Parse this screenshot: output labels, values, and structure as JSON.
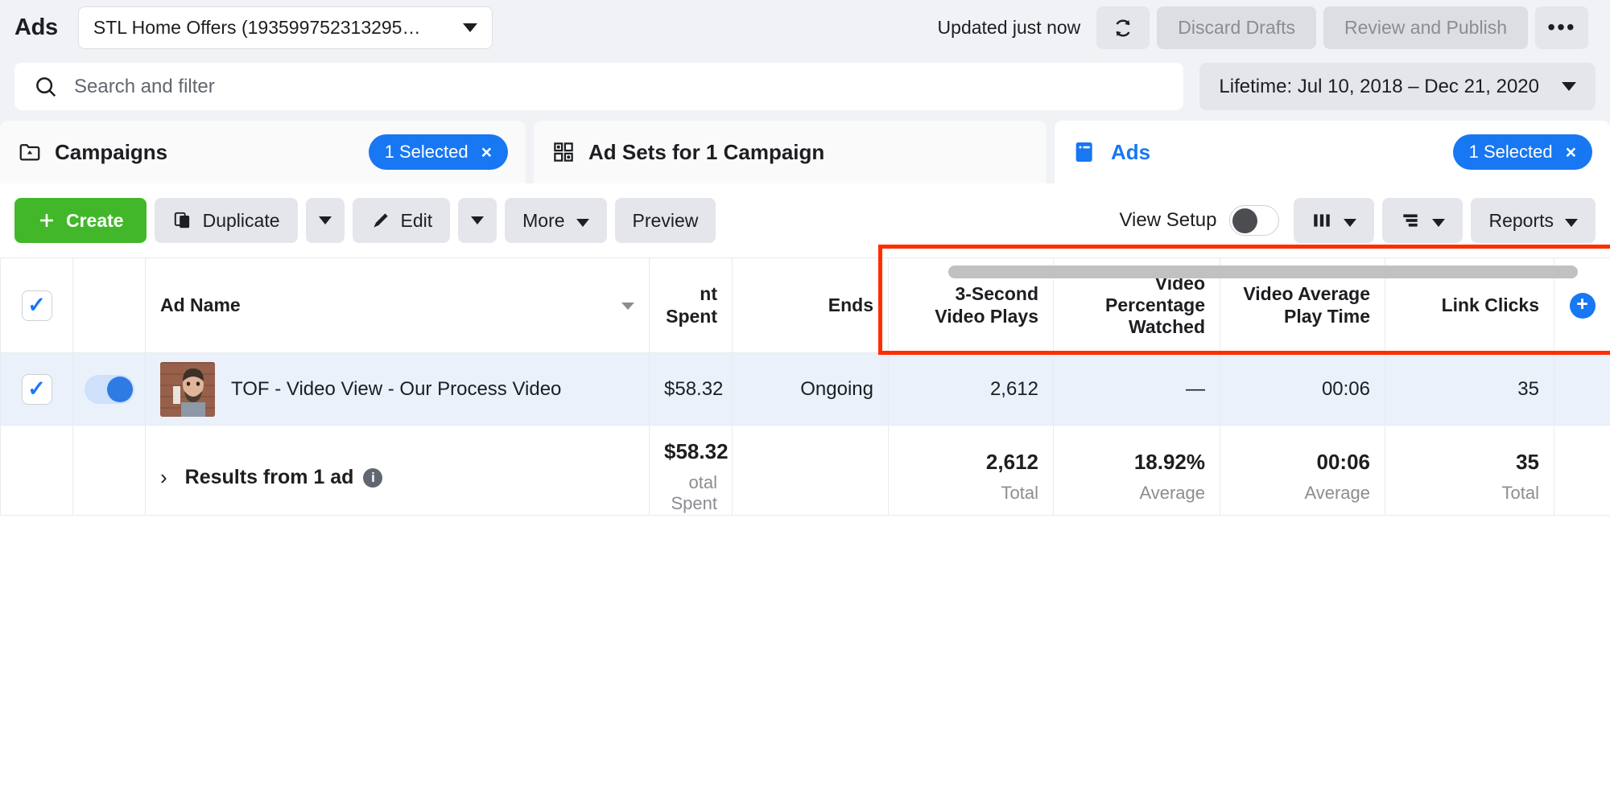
{
  "header": {
    "app_title": "Ads",
    "account_selector": {
      "value": "STL Home Offers (193599752313295…",
      "icon": "chevron-down-icon"
    },
    "updated_status": "Updated just now",
    "refresh_icon": "refresh-icon",
    "discard_drafts_label": "Discard Drafts",
    "review_publish_label": "Review and Publish",
    "more_options_icon": "ellipsis-icon"
  },
  "search": {
    "placeholder": "Search and filter",
    "icon": "search-icon",
    "date_range": "Lifetime: Jul 10, 2018 – Dec 21, 2020"
  },
  "tabs": [
    {
      "label": "Campaigns",
      "icon": "campaign-folder-icon",
      "badge": "1 Selected",
      "badge_close": "×",
      "active": false
    },
    {
      "label": "Ad Sets for 1 Campaign",
      "icon": "adset-grid-icon",
      "badge": null,
      "active": false
    },
    {
      "label": "Ads",
      "icon": "ads-card-icon",
      "badge": "1 Selected",
      "badge_close": "×",
      "active": true
    }
  ],
  "toolbar": {
    "create_label": "Create",
    "duplicate_label": "Duplicate",
    "edit_label": "Edit",
    "more_label": "More",
    "preview_label": "Preview",
    "view_setup_label": "View Setup",
    "columns_icon": "columns-icon",
    "breakdown_icon": "breakdown-icon",
    "reports_label": "Reports"
  },
  "table": {
    "columns": [
      {
        "key": "checkbox",
        "label": "",
        "align": "center"
      },
      {
        "key": "toggle",
        "label": "",
        "align": "center"
      },
      {
        "key": "ad_name",
        "label": "Ad Name",
        "align": "left",
        "sortable": true
      },
      {
        "key": "amount_spent",
        "label": "nt Spent",
        "align": "right"
      },
      {
        "key": "ends",
        "label": "Ends",
        "align": "right"
      },
      {
        "key": "three_second_video_plays",
        "label": "3-Second Video Plays",
        "align": "right"
      },
      {
        "key": "video_percentage_watched",
        "label": "Video Percentage Watched",
        "align": "right"
      },
      {
        "key": "video_average_play_time",
        "label": "Video Average Play Time",
        "align": "right"
      },
      {
        "key": "link_clicks",
        "label": "Link Clicks",
        "align": "right"
      },
      {
        "key": "add_column",
        "label": "",
        "align": "center"
      }
    ],
    "rows": [
      {
        "selected": true,
        "toggle_on": true,
        "ad_name": "TOF - Video View - Our Process Video",
        "amount_spent": "$58.32",
        "ends": "Ongoing",
        "three_second_video_plays": "2,612",
        "video_percentage_watched": "—",
        "video_average_play_time": "00:06",
        "link_clicks": "35"
      }
    ],
    "summary": {
      "label": "Results from 1 ad",
      "expand_icon": "chevron-right-icon",
      "info_icon": "info-icon",
      "amount_spent": {
        "value": "$58.32",
        "sub": "otal Spent"
      },
      "ends": {
        "value": "",
        "sub": ""
      },
      "three_second_video_plays": {
        "value": "2,612",
        "sub": "Total"
      },
      "video_percentage_watched": {
        "value": "18.92%",
        "sub": "Average"
      },
      "video_average_play_time": {
        "value": "00:06",
        "sub": "Average"
      },
      "link_clicks": {
        "value": "35",
        "sub": "Total"
      }
    }
  },
  "annotation": {
    "highlight_color": "#ff2d00",
    "highlight_note": "red rectangle around video metric columns"
  },
  "colors": {
    "brand_blue": "#1877f2",
    "create_green": "#42b72a",
    "row_selected_bg": "#eaf1fb",
    "page_bg": "#f0f2f5"
  }
}
